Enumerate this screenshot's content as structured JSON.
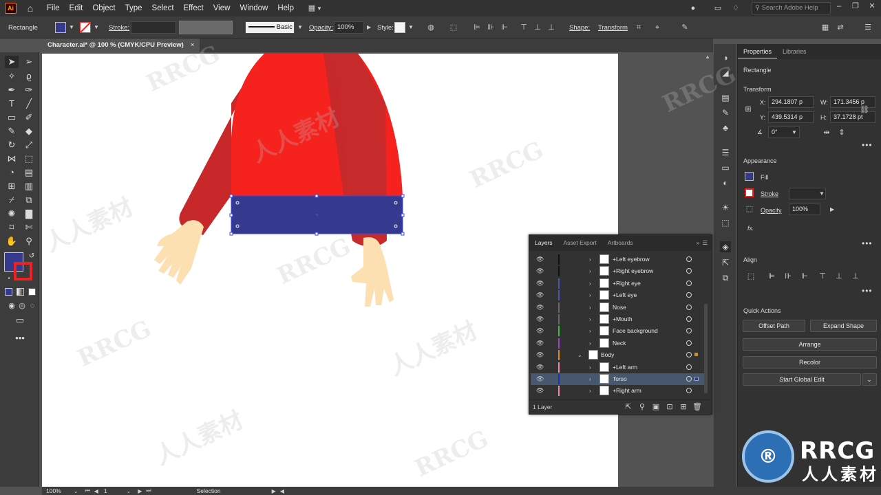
{
  "app": {
    "logo_text": "Ai",
    "menus": [
      "File",
      "Edit",
      "Object",
      "Type",
      "Select",
      "Effect",
      "View",
      "Window",
      "Help"
    ],
    "search_placeholder": "Search Adobe Help"
  },
  "control_bar": {
    "selection_type": "Rectangle",
    "fill_color": "#363a8f",
    "stroke_label": "Stroke:",
    "brush_label": "Basic",
    "opacity_label": "Opacity:",
    "opacity_value": "100%",
    "style_label": "Style:",
    "shape_label": "Shape:",
    "transform_label": "Transform"
  },
  "document": {
    "tab_title": "Character.ai* @ 100 % (CMYK/CPU Preview)",
    "close_symbol": "×"
  },
  "properties": {
    "tabs": [
      "Properties",
      "Libraries"
    ],
    "object_type": "Rectangle",
    "transform_title": "Transform",
    "x_label": "X:",
    "x_value": "294.1807 p",
    "y_label": "Y:",
    "y_value": "439.5314 p",
    "w_label": "W:",
    "w_value": "171.3456 p",
    "h_label": "H:",
    "h_value": "37.1728 pt",
    "angle_value": "0°",
    "appearance_title": "Appearance",
    "fill_label": "Fill",
    "stroke_label": "Stroke",
    "opacity_label": "Opacity",
    "opacity_value": "100%",
    "fx_label": "fx.",
    "align_title": "Align",
    "quick_actions_title": "Quick Actions",
    "btn_offset_path": "Offset Path",
    "btn_expand_shape": "Expand Shape",
    "btn_arrange": "Arrange",
    "btn_recolor": "Recolor",
    "btn_global_edit": "Start Global Edit"
  },
  "layers_panel": {
    "tabs": [
      "Layers",
      "Asset Export",
      "Artboards"
    ],
    "footer_count": "1 Layer",
    "rows": [
      {
        "name": "+Left eyebrow",
        "color": "#111111",
        "expanded": false,
        "selected": false
      },
      {
        "name": "+Right eyebrow",
        "color": "#111111",
        "expanded": false,
        "selected": false
      },
      {
        "name": "+Right eye",
        "color": "#4a55b5",
        "expanded": false,
        "selected": false
      },
      {
        "name": "+Left eye",
        "color": "#4a55b5",
        "expanded": false,
        "selected": false
      },
      {
        "name": "Nose",
        "color": "#6a6a6a",
        "expanded": false,
        "selected": false
      },
      {
        "name": "+Mouth",
        "color": "#6a6a6a",
        "expanded": false,
        "selected": false
      },
      {
        "name": "Face background",
        "color": "#3fbf3f",
        "expanded": false,
        "selected": false
      },
      {
        "name": "Neck",
        "color": "#9b45c9",
        "expanded": false,
        "selected": false
      },
      {
        "name": "Body",
        "color": "#e08a10",
        "expanded": true,
        "selected": false
      },
      {
        "name": "+Left arm",
        "color": "#f08aa0",
        "expanded": false,
        "selected": false
      },
      {
        "name": "Torso",
        "color": "#2233aa",
        "expanded": false,
        "selected": true
      },
      {
        "name": "+Right arm",
        "color": "#f08aa0",
        "expanded": false,
        "selected": false
      }
    ]
  },
  "status_bar": {
    "zoom": "100%",
    "artboard_number": "1",
    "tool_name": "Selection"
  },
  "watermark": {
    "text_latin": "RRCG",
    "text_cjk": "人人素材"
  }
}
